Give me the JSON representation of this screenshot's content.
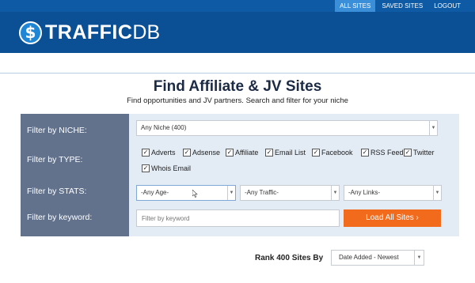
{
  "nav": {
    "links": [
      {
        "label": "ALL SITES",
        "active": true
      },
      {
        "label": "SAVED SITES",
        "active": false
      },
      {
        "label": "LOGOUT",
        "active": false
      }
    ]
  },
  "brand": {
    "symbol": "$",
    "word1": "TRAFFIC",
    "word2": "DB"
  },
  "hero": {
    "title": "Find Affiliate & JV Sites",
    "subtitle": "Find opportunities and JV partners. Search and filter for your niche"
  },
  "filters": {
    "niche": {
      "label": "Filter by NICHE:",
      "value": "Any Niche (400)"
    },
    "type": {
      "label": "Filter by TYPE:",
      "options": [
        {
          "label": "Adverts",
          "checked": true
        },
        {
          "label": "Adsense",
          "checked": true
        },
        {
          "label": "Affiliate",
          "checked": true
        },
        {
          "label": "Email List",
          "checked": true
        },
        {
          "label": "Facebook",
          "checked": true
        },
        {
          "label": "RSS Feed",
          "checked": true
        },
        {
          "label": "Twitter",
          "checked": true
        },
        {
          "label": "Whois Email",
          "checked": true
        }
      ]
    },
    "stats": {
      "label": "Filter by STATS:",
      "age": "-Any Age-",
      "traffic": "-Any Traffic-",
      "links": "-Any Links-"
    },
    "keyword": {
      "label": "Filter by keyword:",
      "placeholder": "Filter by keyword",
      "value": ""
    },
    "submit_label": "Load All Sites ›"
  },
  "ranking": {
    "label": "Rank 400 Sites By",
    "value": "Date Added - Newest"
  },
  "colors": {
    "nav": "#0e5aa4",
    "header": "#0b4f95",
    "labels_panel": "#62728d",
    "filter_panel": "#e3ecf5",
    "accent_button": "#f26a1b"
  }
}
